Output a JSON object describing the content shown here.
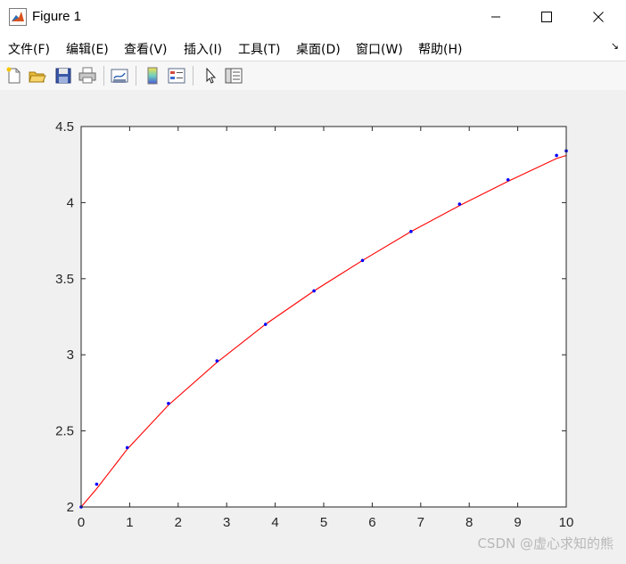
{
  "window": {
    "title": "Figure 1"
  },
  "menu": {
    "items": [
      "文件(F)",
      "编辑(E)",
      "查看(V)",
      "插入(I)",
      "工具(T)",
      "桌面(D)",
      "窗口(W)",
      "帮助(H)"
    ],
    "overflow_icon": "menu-overflow-arrow"
  },
  "toolbar": {
    "icons": [
      "new-figure-icon",
      "open-file-icon",
      "save-icon",
      "print-icon",
      "link-plot-icon",
      "colorbar-icon",
      "legend-icon",
      "pointer-icon",
      "property-inspector-icon"
    ]
  },
  "chart_data": {
    "type": "scatter",
    "title": "",
    "xlabel": "",
    "ylabel": "",
    "xlim": [
      0,
      10
    ],
    "ylim": [
      2,
      4.5
    ],
    "xticks": [
      "0",
      "1",
      "2",
      "3",
      "4",
      "5",
      "6",
      "7",
      "8",
      "9",
      "10"
    ],
    "yticks": [
      "2",
      "2.5",
      "3",
      "3.5",
      "4",
      "4.5"
    ],
    "grid": false,
    "series": [
      {
        "kind": "points",
        "color": "#0000ff",
        "x": [
          0,
          0.32,
          0.95,
          1.8,
          2.8,
          3.8,
          4.8,
          5.8,
          6.8,
          7.8,
          8.8,
          9.8,
          10
        ],
        "y": [
          2.0,
          2.15,
          2.39,
          2.68,
          2.96,
          3.2,
          3.42,
          3.62,
          3.81,
          3.99,
          4.15,
          4.31,
          4.34
        ]
      },
      {
        "kind": "line",
        "color": "#ff0000",
        "x": [
          0,
          0.32,
          0.95,
          1.8,
          2.8,
          3.8,
          4.8,
          5.8,
          6.8,
          7.8,
          8.8,
          9.8,
          10
        ],
        "y": [
          2.0,
          2.12,
          2.38,
          2.67,
          2.95,
          3.2,
          3.42,
          3.62,
          3.81,
          3.98,
          4.14,
          4.29,
          4.31
        ]
      }
    ]
  },
  "watermark": "CSDN @虚心求知的熊"
}
